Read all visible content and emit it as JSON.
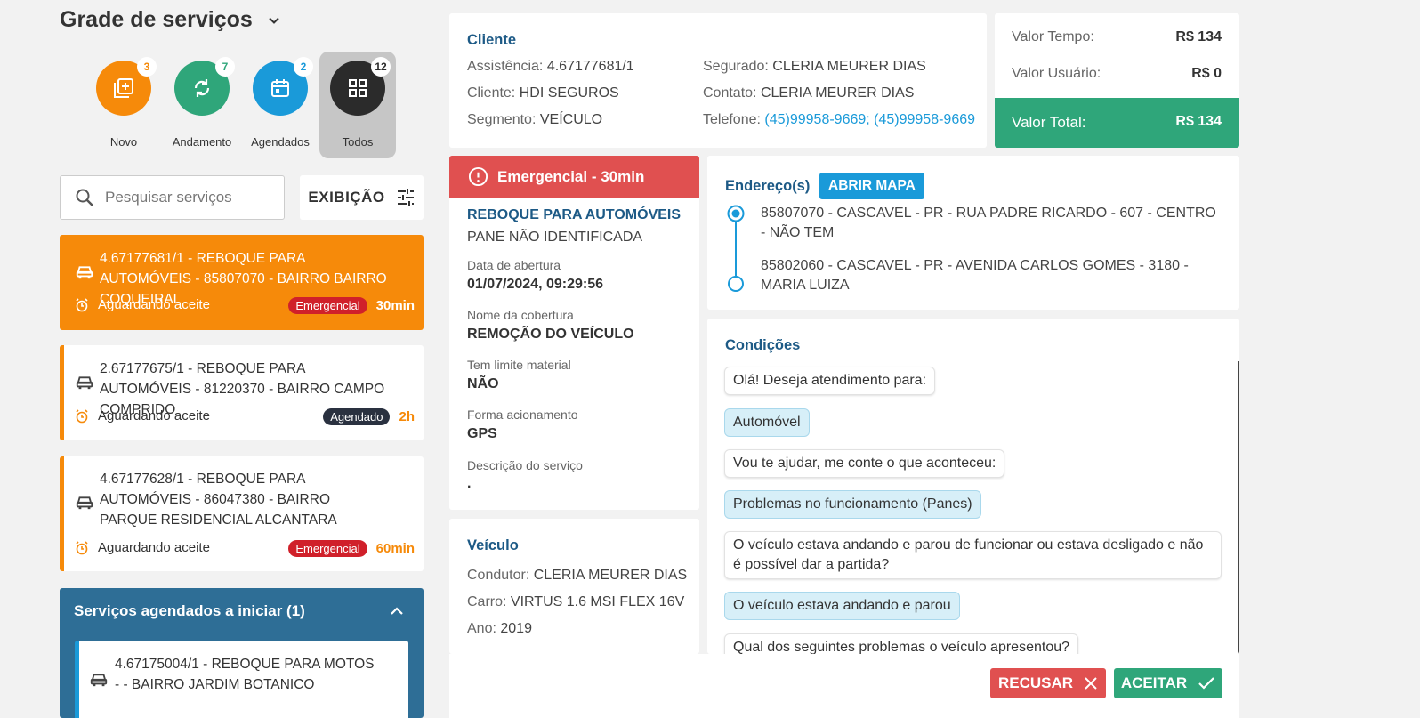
{
  "header": {
    "title": "Grade de serviços"
  },
  "filters": [
    {
      "label": "Novo",
      "count": "3",
      "color": "#f68a0a"
    },
    {
      "label": "Andamento",
      "count": "7",
      "color": "#2fa67a"
    },
    {
      "label": "Agendados",
      "count": "2",
      "color": "#1a9ad9"
    },
    {
      "label": "Todos",
      "count": "12",
      "color": "#2b2b2b"
    }
  ],
  "search": {
    "placeholder": "Pesquisar serviços"
  },
  "exibicao_label": "EXIBIÇÃO",
  "services": [
    {
      "title": "4.67177681/1 - REBOQUE PARA AUTOMÓVEIS - 85807070 - BAIRRO BAIRRO COQUEIRAL",
      "status": "Aguardando aceite",
      "tag": "Emergencial",
      "time": "30min"
    },
    {
      "title": "2.67177675/1 - REBOQUE PARA AUTOMÓVEIS - 81220370 - BAIRRO CAMPO COMPRIDO",
      "status": "Aguardando aceite",
      "tag": "Agendado",
      "time": "2h"
    },
    {
      "title": "4.67177628/1 - REBOQUE PARA AUTOMÓVEIS - 86047380 - BAIRRO PARQUE RESIDENCIAL ALCANTARA",
      "status": "Aguardando aceite",
      "tag": "Emergencial",
      "time": "60min"
    }
  ],
  "scheduled": {
    "header": "Serviços agendados a iniciar (1)",
    "item_title": "4.67175004/1 - REBOQUE PARA MOTOS - - BAIRRO JARDIM BOTANICO"
  },
  "client": {
    "heading": "Cliente",
    "assistencia_label": "Assistência:",
    "assistencia": "4.67177681/1",
    "cliente_label": "Cliente:",
    "cliente": "HDI SEGUROS",
    "segmento_label": "Segmento:",
    "segmento": "VEÍCULO",
    "segurado_label": "Segurado:",
    "segurado": "CLERIA MEURER DIAS",
    "contato_label": "Contato:",
    "contato": "CLERIA MEURER DIAS",
    "telefone_label": "Telefone:",
    "telefone": "(45)99958-9669; (45)99958-9669"
  },
  "values": {
    "tempo_label": "Valor Tempo:",
    "tempo": "R$ 134",
    "usuario_label": "Valor Usuário:",
    "usuario": "R$ 0",
    "total_label": "Valor Total:",
    "total": "R$ 134"
  },
  "service_detail": {
    "banner": "Emergencial - 30min",
    "type": "REBOQUE PARA AUTOMÓVEIS",
    "subtype": "PANE NÃO IDENTIFICADA",
    "data_label": "Data de abertura",
    "data": "01/07/2024, 09:29:56",
    "cobertura_label": "Nome da cobertura",
    "cobertura": "REMOÇÃO DO VEÍCULO",
    "limite_label": "Tem limite material",
    "limite": "NÃO",
    "forma_label": "Forma acionamento",
    "forma": "GPS",
    "descricao_label": "Descrição do serviço",
    "descricao": "."
  },
  "vehicle": {
    "heading": "Veículo",
    "condutor_label": "Condutor:",
    "condutor": "CLERIA MEURER DIAS",
    "carro_label": "Carro:",
    "carro": "VIRTUS 1.6 MSI FLEX 16V",
    "ano_label": "Ano:",
    "ano": "2019"
  },
  "address": {
    "heading": "Endereço(s)",
    "map_button": "ABRIR MAPA",
    "origin": "85807070 - CASCAVEL - PR - RUA PADRE RICARDO - 607 - CENTRO - NÃO TEM",
    "destination": "85802060 - CASCAVEL - PR - AVENIDA CARLOS GOMES - 3180 - MARIA LUIZA"
  },
  "conditions": {
    "heading": "Condições",
    "messages": [
      "Olá! Deseja atendimento para:",
      "Automóvel",
      "Vou te ajudar, me conte o que aconteceu:",
      "Problemas no funcionamento (Panes)",
      "O veículo estava andando e parou de funcionar ou estava desligado e não é possível dar a partida?",
      "O veículo estava andando e parou",
      "Qual dos seguintes problemas o veículo apresentou?"
    ]
  },
  "actions": {
    "refuse": "RECUSAR",
    "accept": "ACEITAR"
  },
  "colors": {
    "orange": "#f68a0a",
    "green": "#2fa67a",
    "blue": "#1a9ad9",
    "red": "#e05050",
    "navy": "#1d5a86",
    "dark_red": "#d0202a",
    "dark_pill": "#2a3140"
  }
}
